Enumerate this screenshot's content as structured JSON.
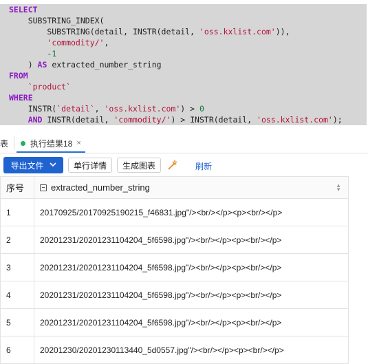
{
  "editor": {
    "lines": [
      [
        {
          "t": "SELECT",
          "c": "kw"
        }
      ],
      [
        {
          "t": "    SUBSTRING_INDEX(",
          "c": ""
        }
      ],
      [
        {
          "t": "        SUBSTRING(detail, INSTR(detail, ",
          "c": ""
        },
        {
          "t": "'oss.kxlist.com'",
          "c": "str"
        },
        {
          "t": ")),",
          "c": ""
        }
      ],
      [
        {
          "t": "        ",
          "c": ""
        },
        {
          "t": "'commodity/'",
          "c": "str"
        },
        {
          "t": ",",
          "c": ""
        }
      ],
      [
        {
          "t": "        ",
          "c": ""
        },
        {
          "t": "-1",
          "c": "num"
        }
      ],
      [
        {
          "t": "    ) ",
          "c": ""
        },
        {
          "t": "AS",
          "c": "kw"
        },
        {
          "t": " extracted_number_string",
          "c": ""
        }
      ],
      [
        {
          "t": "FROM",
          "c": "kw"
        }
      ],
      [
        {
          "t": "    ",
          "c": ""
        },
        {
          "t": "`product`",
          "c": "str"
        }
      ],
      [
        {
          "t": "WHERE",
          "c": "kw"
        }
      ],
      [
        {
          "t": "    INSTR(",
          "c": ""
        },
        {
          "t": "`detail`",
          "c": "str"
        },
        {
          "t": ", ",
          "c": ""
        },
        {
          "t": "'oss.kxlist.com'",
          "c": "str"
        },
        {
          "t": ") > ",
          "c": ""
        },
        {
          "t": "0",
          "c": "num"
        }
      ],
      [
        {
          "t": "    ",
          "c": ""
        },
        {
          "t": "AND",
          "c": "kw"
        },
        {
          "t": " INSTR(detail, ",
          "c": ""
        },
        {
          "t": "'commodity/'",
          "c": "str"
        },
        {
          "t": ") > INSTR(detail, ",
          "c": ""
        },
        {
          "t": "'oss.kxlist.com'",
          "c": "str"
        },
        {
          "t": ");",
          "c": ""
        }
      ]
    ]
  },
  "tabs": {
    "prev_tab_label": "表",
    "active_tab_label": "执行结果18",
    "close_glyph": "×"
  },
  "toolbar": {
    "export_label": "导出文件",
    "detail_label": "单行详情",
    "chart_label": "生成图表",
    "refresh_label": "刷新"
  },
  "grid": {
    "columns": [
      "序号",
      "extracted_number_string"
    ],
    "rows": [
      [
        "1",
        "20170925/20170925190215_f46831.jpg\"/><br/></p><p><br/></p>"
      ],
      [
        "2",
        "20201231/20201231104204_5f6598.jpg\"/><br/></p><p><br/></p>"
      ],
      [
        "3",
        "20201231/20201231104204_5f6598.jpg\"/><br/></p><p><br/></p>"
      ],
      [
        "4",
        "20201231/20201231104204_5f6598.jpg\"/><br/></p><p><br/></p>"
      ],
      [
        "5",
        "20201231/20201231104204_5f6598.jpg\"/><br/></p><p><br/></p>"
      ],
      [
        "6",
        "20201230/20201230113440_5d0557.jpg\"/><br/></p><p><br/></p>"
      ]
    ]
  },
  "colors": {
    "primary": "#1f63d1",
    "selection": "#d6d6d6",
    "keyword": "#8b1ac4",
    "string": "#b3123a",
    "number": "#0b7a3b",
    "active_dot": "#1fb35a"
  }
}
